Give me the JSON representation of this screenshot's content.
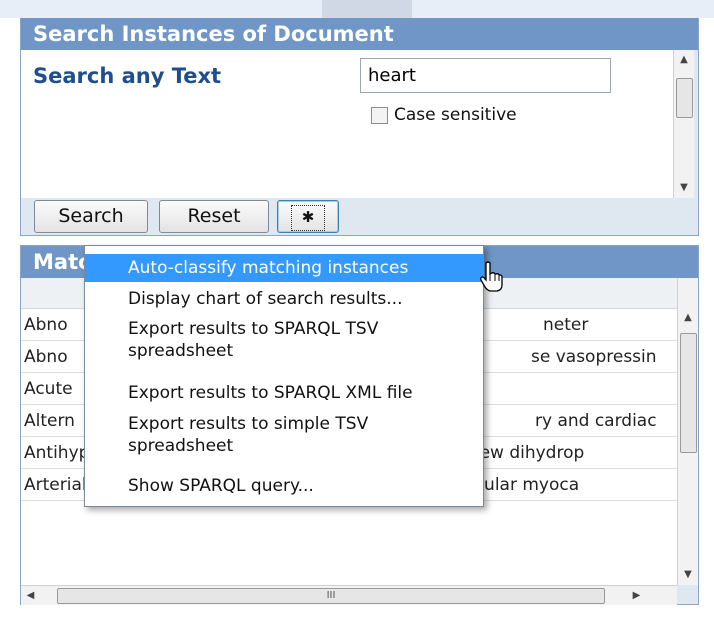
{
  "search_panel": {
    "title": "Search Instances of Document",
    "label": "Search any Text",
    "input_value": "heart",
    "case_sensitive_label": "Case sensitive",
    "case_sensitive_checked": false,
    "buttons": {
      "search": "Search",
      "reset": "Reset",
      "options_icon": "gear-icon"
    }
  },
  "match_panel": {
    "title_visible": "Matc",
    "rows": [
      {
        "left": "Abno",
        "right": "neter"
      },
      {
        "left": "Abno",
        "right": "se vasopressin"
      },
      {
        "left": "Acute",
        "right": ""
      },
      {
        "left": "Altern",
        "right": "ry and cardiac"
      },
      {
        "full": "Antihypertensive activity of isradipine in humans: a new dihydrop"
      },
      {
        "full": "Arterial-venous relationships in the human left ventricular myoca"
      }
    ],
    "hscroll_glyph": "III"
  },
  "context_menu": {
    "items": [
      {
        "label": "Auto-classify matching instances",
        "highlighted": true
      },
      {
        "label": "Display chart of search results..."
      },
      {
        "label": "Export results to SPARQL TSV spreadsheet"
      },
      {
        "label": "Export results to SPARQL XML file"
      },
      {
        "label": "Export results to simple TSV spreadsheet"
      },
      {
        "label": "Show SPARQL query..."
      }
    ]
  },
  "colors": {
    "header_blue": "#6f96c6",
    "panel_bg": "#dfe7f1",
    "label_blue": "#1f4e8c",
    "menu_highlight": "#3399ff"
  }
}
